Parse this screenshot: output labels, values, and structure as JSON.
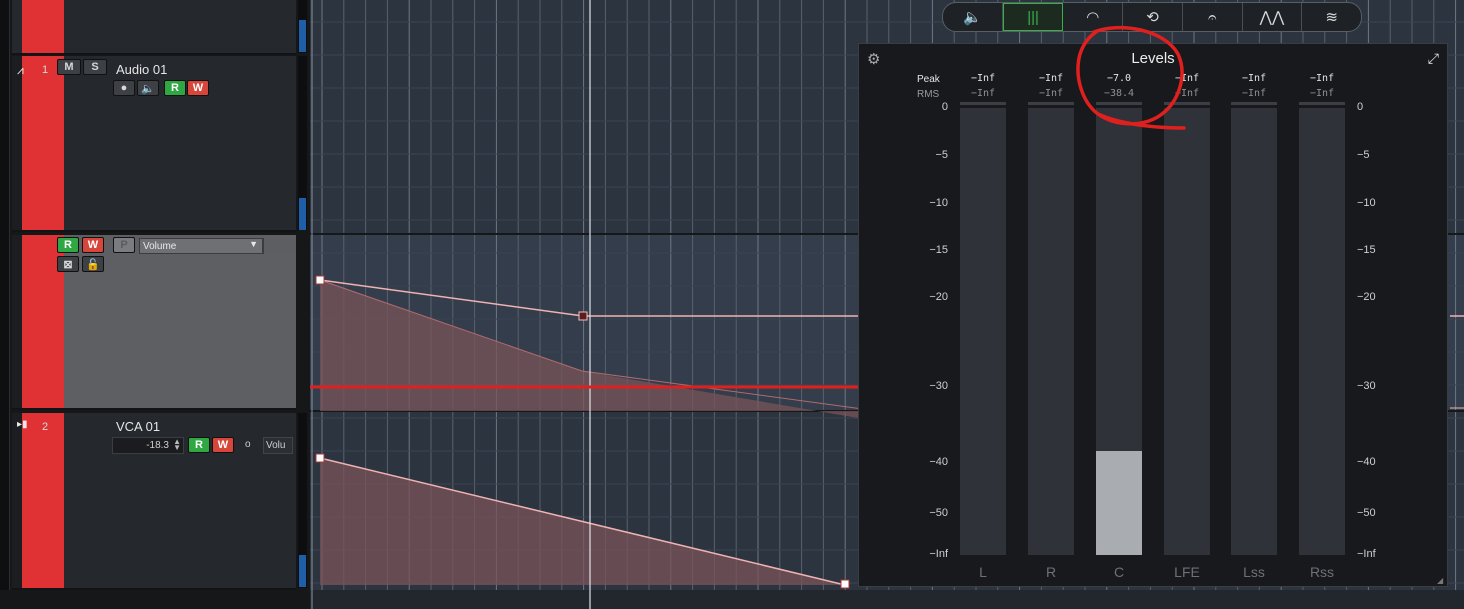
{
  "tracks": {
    "audio": {
      "number": "1",
      "name": "Audio 01",
      "mute": "M",
      "solo": "S",
      "read": "R",
      "write": "W"
    },
    "automation": {
      "read": "R",
      "write": "W",
      "p": "P",
      "parameter": "Volume"
    },
    "vca": {
      "number": "2",
      "name": "VCA 01",
      "value": "-18.3",
      "read": "R",
      "write": "W",
      "sel": "Volu"
    }
  },
  "toolbar": {
    "buttons": [
      {
        "name": "speaker-icon",
        "glyph": "🔈"
      },
      {
        "name": "levels-icon",
        "glyph": "|||"
      },
      {
        "name": "gauge-icon",
        "glyph": "◠"
      },
      {
        "name": "history-icon",
        "glyph": "⟲"
      },
      {
        "name": "ear-icon",
        "glyph": "𝄐"
      },
      {
        "name": "waveform-icon",
        "glyph": "⋀⋀"
      },
      {
        "name": "spectrum-icon",
        "glyph": "≋"
      }
    ],
    "active_index": 1
  },
  "panel": {
    "title": "Levels",
    "peak_label": "Peak",
    "rms_label": "RMS",
    "channels": [
      {
        "name": "L",
        "peak": "−Inf",
        "rms": "−Inf",
        "level_db": null
      },
      {
        "name": "R",
        "peak": "−Inf",
        "rms": "−Inf",
        "level_db": null
      },
      {
        "name": "C",
        "peak": "−7.0",
        "rms": "−38.4",
        "level_db": -38.4
      },
      {
        "name": "LFE",
        "peak": "−Inf",
        "rms": "−Inf",
        "level_db": null
      },
      {
        "name": "Lss",
        "peak": "−Inf",
        "rms": "−Inf",
        "level_db": null
      },
      {
        "name": "Rss",
        "peak": "−Inf",
        "rms": "−Inf",
        "level_db": null
      }
    ],
    "scale": [
      "0",
      "−5",
      "−10",
      "−15",
      "−20",
      "−30",
      "−40",
      "−50",
      "−Inf"
    ],
    "scale_db": [
      0,
      -5,
      -10,
      -15,
      -20,
      -30,
      -40,
      -50,
      -60
    ]
  },
  "colors": {
    "track_color": "#e03234",
    "annotation": "#e0201e",
    "active": "#38b04a"
  }
}
